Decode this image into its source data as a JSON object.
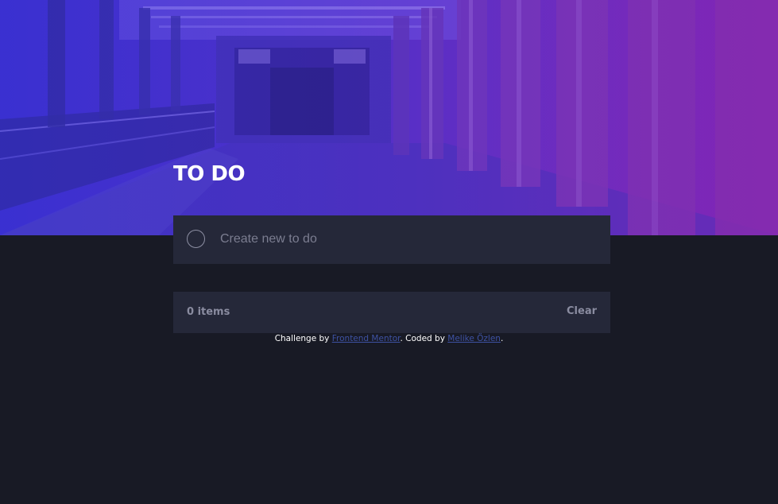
{
  "header": {
    "title": "TO DO"
  },
  "new_todo": {
    "placeholder": "Create new to do",
    "value": ""
  },
  "footer": {
    "items_left": "0 items",
    "clear_label": "Clear"
  },
  "attribution": {
    "prefix": "Challenge by ",
    "challenge_link": "Frontend Mentor",
    "middle": ". Coded by ",
    "author_link": "Melike Özlen",
    "suffix": "."
  },
  "colors": {
    "page_bg": "#181a25",
    "card_bg": "#252839",
    "muted_text": "#8a8ca0",
    "link": "#3e52a3"
  }
}
